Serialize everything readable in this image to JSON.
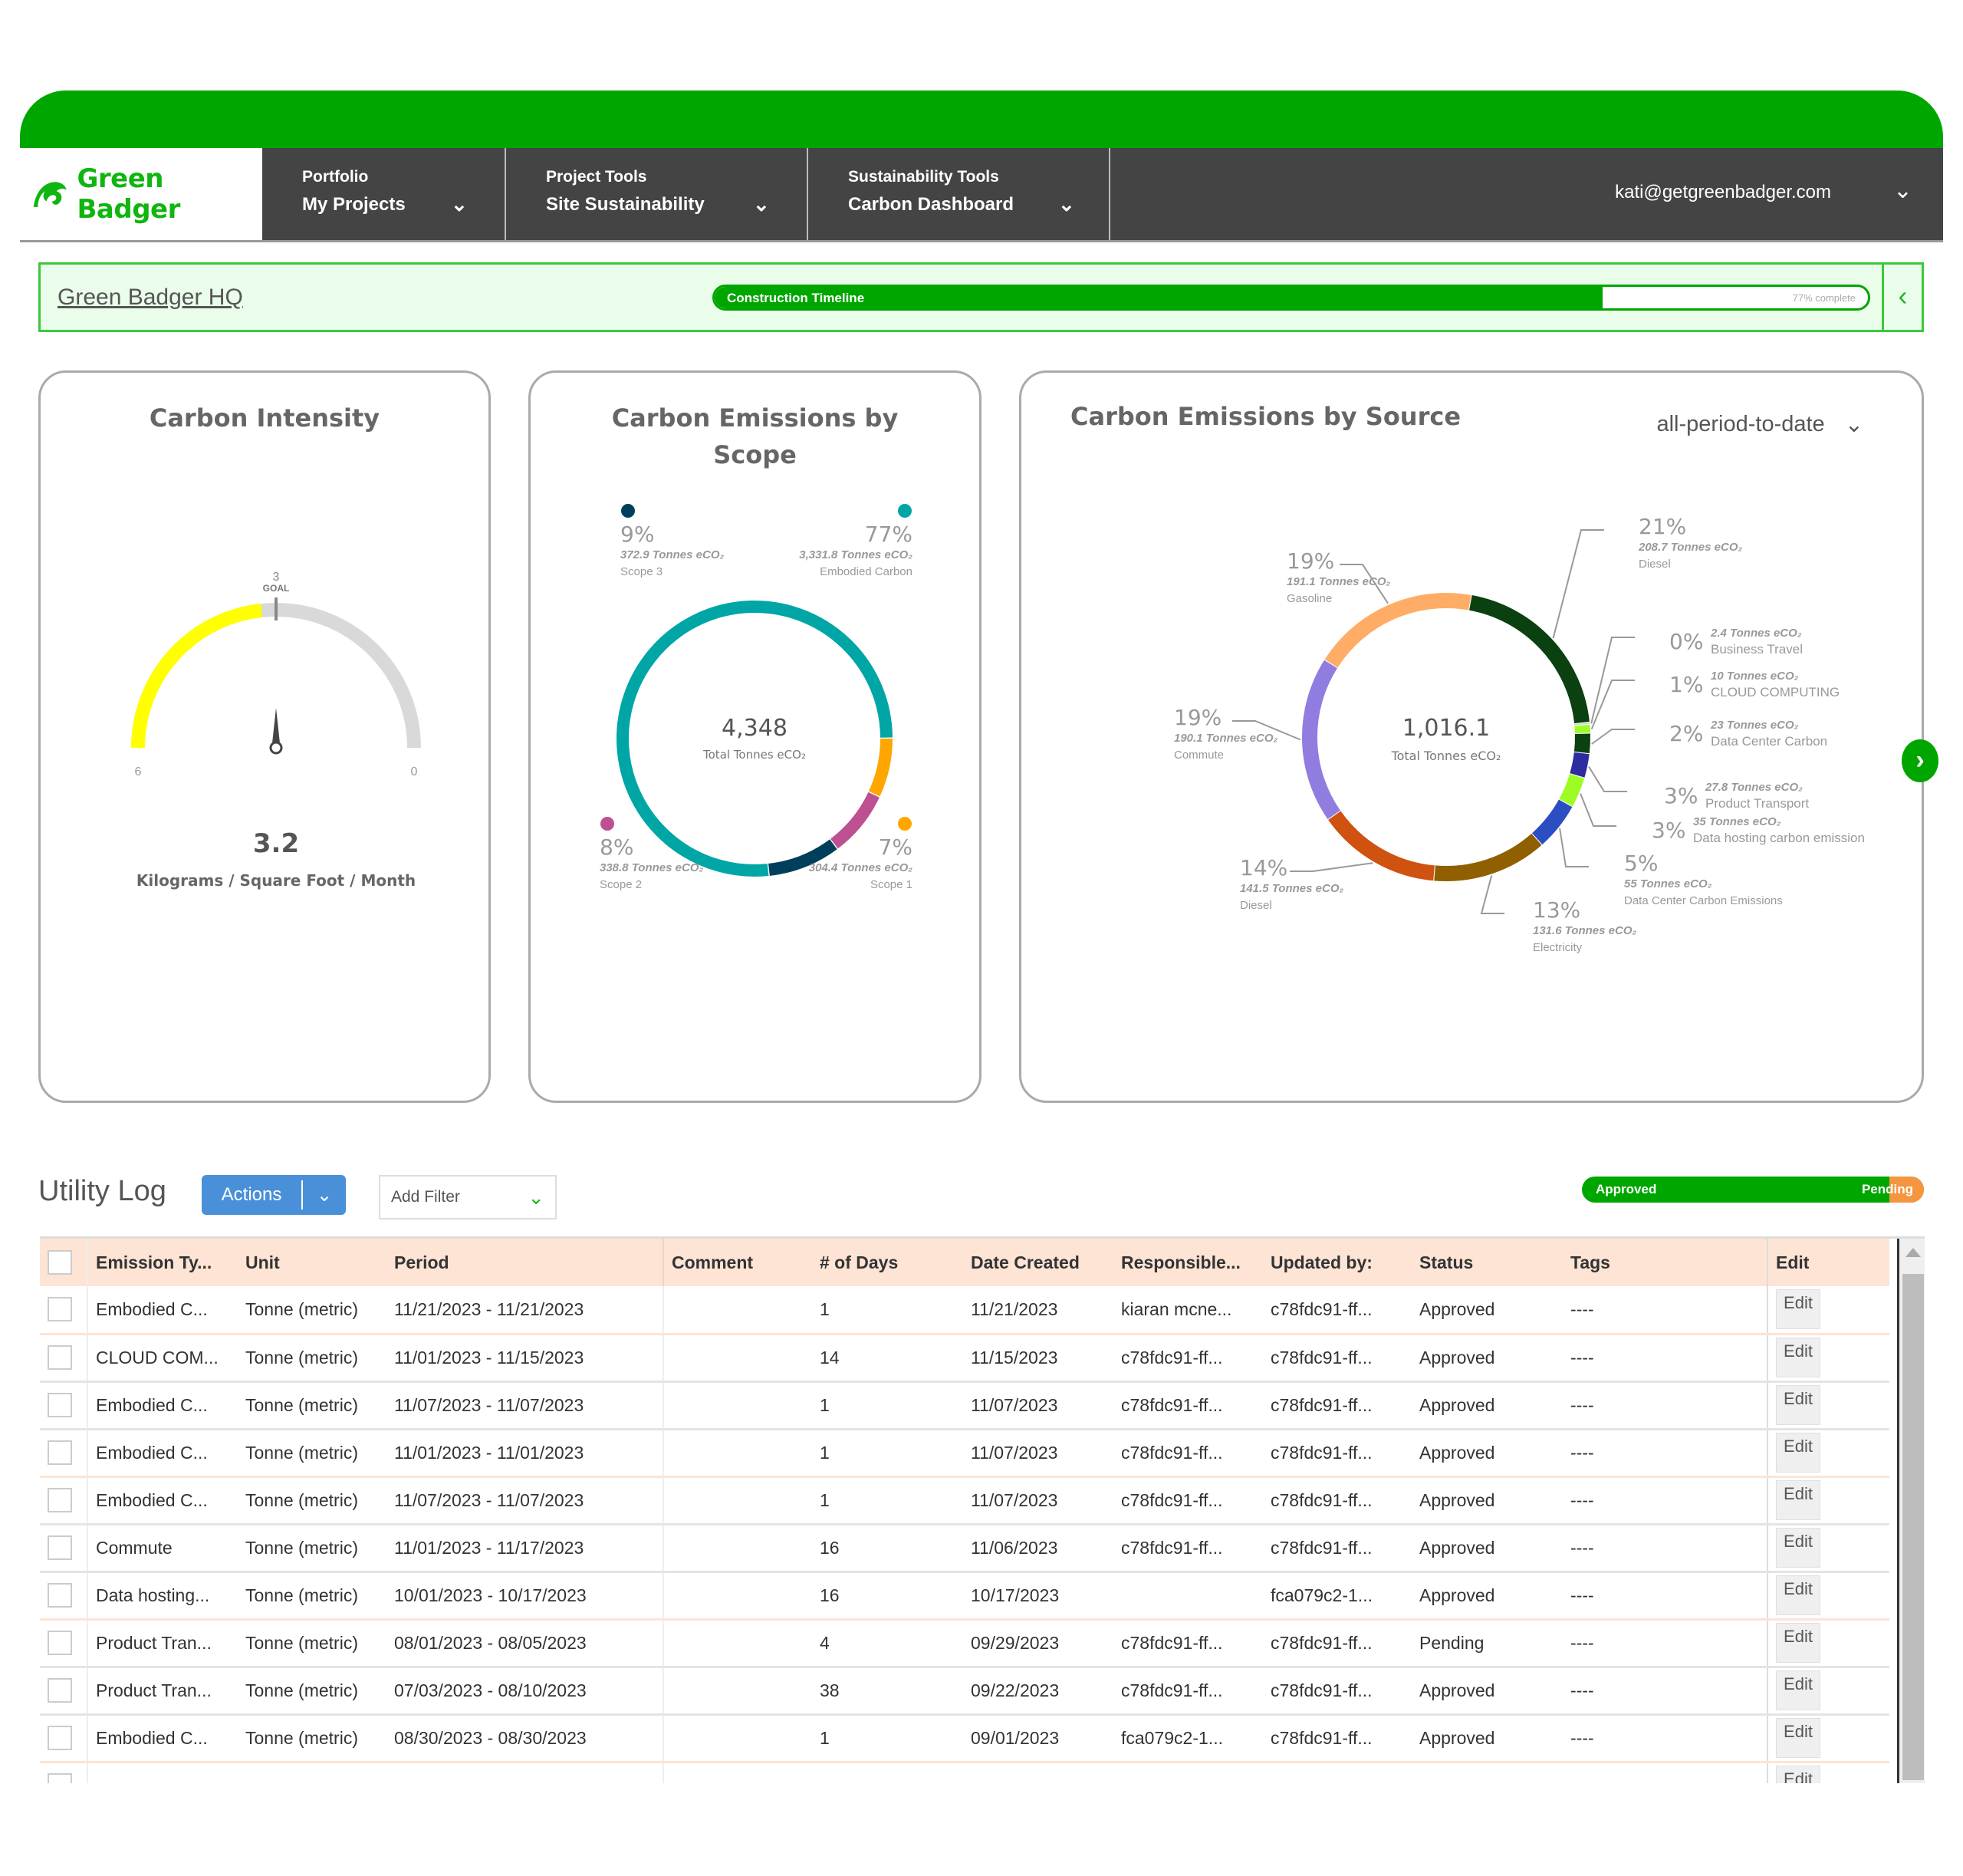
{
  "brand": {
    "name": "Green Badger",
    "primary": "#00a600",
    "accent": "#10b510"
  },
  "nav": {
    "items": [
      {
        "small": "Portfolio",
        "big": "My Projects"
      },
      {
        "small": "Project Tools",
        "big": "Site Sustainability"
      },
      {
        "small": "Sustainability Tools",
        "big": "Carbon Dashboard"
      }
    ],
    "user_email": "kati@getgreenbadger.com"
  },
  "project": {
    "name": "Green Badger HQ",
    "timeline_label": "Construction Timeline",
    "timeline_percent": 77,
    "timeline_text": "77% complete"
  },
  "chart_data": [
    {
      "type": "gauge",
      "title": "Carbon Intensity",
      "value": 3.2,
      "value_label": "3.2",
      "unit": "Kilograms / Square Foot / Month",
      "min": 0,
      "max": 6,
      "min_label": "0",
      "max_label": "6",
      "goal": 3,
      "goal_value_label": "3",
      "goal_label": "GOAL",
      "colors": {
        "fill": "#ffff00",
        "track": "#d9d9d9"
      }
    },
    {
      "type": "pie",
      "title_lines": [
        "Carbon Emissions by",
        "Scope"
      ],
      "center_value": "4,348",
      "center_label": "Total Tonnes eCO₂",
      "slices": [
        {
          "name": "Embodied Carbon",
          "value": 3331.8,
          "percent": "77%",
          "tonnes": "3,331.8 Tonnes eCO₂",
          "color": "#00a6a6",
          "corner": "top-right"
        },
        {
          "name": "Scope 1",
          "value": 304.4,
          "percent": "7%",
          "tonnes": "304.4 Tonnes eCO₂",
          "color": "#ffa600",
          "corner": "bottom-right"
        },
        {
          "name": "Scope 2",
          "value": 338.8,
          "percent": "8%",
          "tonnes": "338.8 Tonnes eCO₂",
          "color": "#bc5090",
          "corner": "bottom-left"
        },
        {
          "name": "Scope 3",
          "value": 372.9,
          "percent": "9%",
          "tonnes": "372.9 Tonnes eCO₂",
          "color": "#003f5c",
          "corner": "top-left"
        }
      ]
    },
    {
      "type": "pie",
      "title": "Carbon Emissions by Source",
      "period_select": "all-period-to-date",
      "center_value": "1,016.1",
      "center_label": "Total Tonnes eCO₂",
      "slices": [
        {
          "name": "Diesel",
          "value": 208.7,
          "percent": "21%",
          "tonnes": "208.7 Tonnes eCO₂",
          "color": "#0b4110"
        },
        {
          "name": "Business Travel",
          "value": 2.4,
          "percent": "0%",
          "tonnes": "2.4 Tonnes eCO₂",
          "color": "#d0d0d0"
        },
        {
          "name": "CLOUD COMPUTING",
          "value": 10,
          "percent": "1%",
          "tonnes": "10 Tonnes eCO₂",
          "color": "#9efc25"
        },
        {
          "name": "Data Center Carbon",
          "value": 23,
          "percent": "2%",
          "tonnes": "23 Tonnes eCO₂",
          "color": "#0b4110"
        },
        {
          "name": "Product Transport",
          "value": 27.8,
          "percent": "3%",
          "tonnes": "27.8 Tonnes eCO₂",
          "color": "#2d2da0"
        },
        {
          "name": "Data hosting carbon emission",
          "value": 35,
          "percent": "3%",
          "tonnes": "35 Tonnes eCO₂",
          "color": "#9efc25"
        },
        {
          "name": "Data Center Carbon Emissions",
          "value": 55,
          "percent": "5%",
          "tonnes": "55 Tonnes eCO₂",
          "color": "#2b4fc2"
        },
        {
          "name": "Electricity",
          "value": 131.6,
          "percent": "13%",
          "tonnes": "131.6 Tonnes eCO₂",
          "color": "#8f5f00"
        },
        {
          "name": "Diesel",
          "value": 141.5,
          "percent": "14%",
          "tonnes": "141.5 Tonnes eCO₂",
          "color": "#cf5210"
        },
        {
          "name": "Commute",
          "value": 190.1,
          "percent": "19%",
          "tonnes": "190.1 Tonnes eCO₂",
          "color": "#917ce0"
        },
        {
          "name": "Gasoline",
          "value": 191.1,
          "percent": "19%",
          "tonnes": "191.1 Tonnes eCO₂",
          "color": "#ffad66"
        }
      ]
    }
  ],
  "utility_log": {
    "title": "Utility Log",
    "actions_label": "Actions",
    "filter_placeholder": "Add Filter",
    "status_bar": {
      "approved_label": "Approved",
      "pending_label": "Pending",
      "approved_fraction": 0.9
    },
    "columns": [
      "Emission Ty...",
      "Unit",
      "Period",
      "Comment",
      "# of Days",
      "Date Created",
      "Responsible...",
      "Updated by:",
      "Status",
      "Tags",
      "Edit"
    ],
    "rows": [
      [
        "Embodied C...",
        "Tonne (metric)",
        "11/21/2023 - 11/21/2023",
        "",
        "1",
        "11/21/2023",
        "kiaran mcne...",
        "c78fdc91-ff...",
        "Approved",
        "----",
        "Edit"
      ],
      [
        "CLOUD COM...",
        "Tonne (metric)",
        "11/01/2023 - 11/15/2023",
        "",
        "14",
        "11/15/2023",
        "c78fdc91-ff...",
        "c78fdc91-ff...",
        "Approved",
        "----",
        "Edit"
      ],
      [
        "Embodied C...",
        "Tonne (metric)",
        "11/07/2023 - 11/07/2023",
        "",
        "1",
        "11/07/2023",
        "c78fdc91-ff...",
        "c78fdc91-ff...",
        "Approved",
        "----",
        "Edit"
      ],
      [
        "Embodied C...",
        "Tonne (metric)",
        "11/01/2023 - 11/01/2023",
        "",
        "1",
        "11/07/2023",
        "c78fdc91-ff...",
        "c78fdc91-ff...",
        "Approved",
        "----",
        "Edit"
      ],
      [
        "Embodied C...",
        "Tonne (metric)",
        "11/07/2023 - 11/07/2023",
        "",
        "1",
        "11/07/2023",
        "c78fdc91-ff...",
        "c78fdc91-ff...",
        "Approved",
        "----",
        "Edit"
      ],
      [
        "Commute",
        "Tonne (metric)",
        "11/01/2023 - 11/17/2023",
        "",
        "16",
        "11/06/2023",
        "c78fdc91-ff...",
        "c78fdc91-ff...",
        "Approved",
        "----",
        "Edit"
      ],
      [
        "Data hosting...",
        "Tonne (metric)",
        "10/01/2023 - 10/17/2023",
        "",
        "16",
        "10/17/2023",
        "",
        "fca079c2-1...",
        "Approved",
        "----",
        "Edit"
      ],
      [
        "Product Tran...",
        "Tonne (metric)",
        "08/01/2023 - 08/05/2023",
        "",
        "4",
        "09/29/2023",
        "c78fdc91-ff...",
        "c78fdc91-ff...",
        "Pending",
        "----",
        "Edit"
      ],
      [
        "Product Tran...",
        "Tonne (metric)",
        "07/03/2023 - 08/10/2023",
        "",
        "38",
        "09/22/2023",
        "c78fdc91-ff...",
        "c78fdc91-ff...",
        "Approved",
        "----",
        "Edit"
      ],
      [
        "Embodied C...",
        "Tonne (metric)",
        "08/30/2023 - 08/30/2023",
        "",
        "1",
        "09/01/2023",
        "fca079c2-1...",
        "c78fdc91-ff...",
        "Approved",
        "----",
        "Edit"
      ],
      [
        "",
        "",
        "",
        "",
        "",
        "",
        "",
        "",
        "",
        "",
        "Edit"
      ]
    ]
  }
}
